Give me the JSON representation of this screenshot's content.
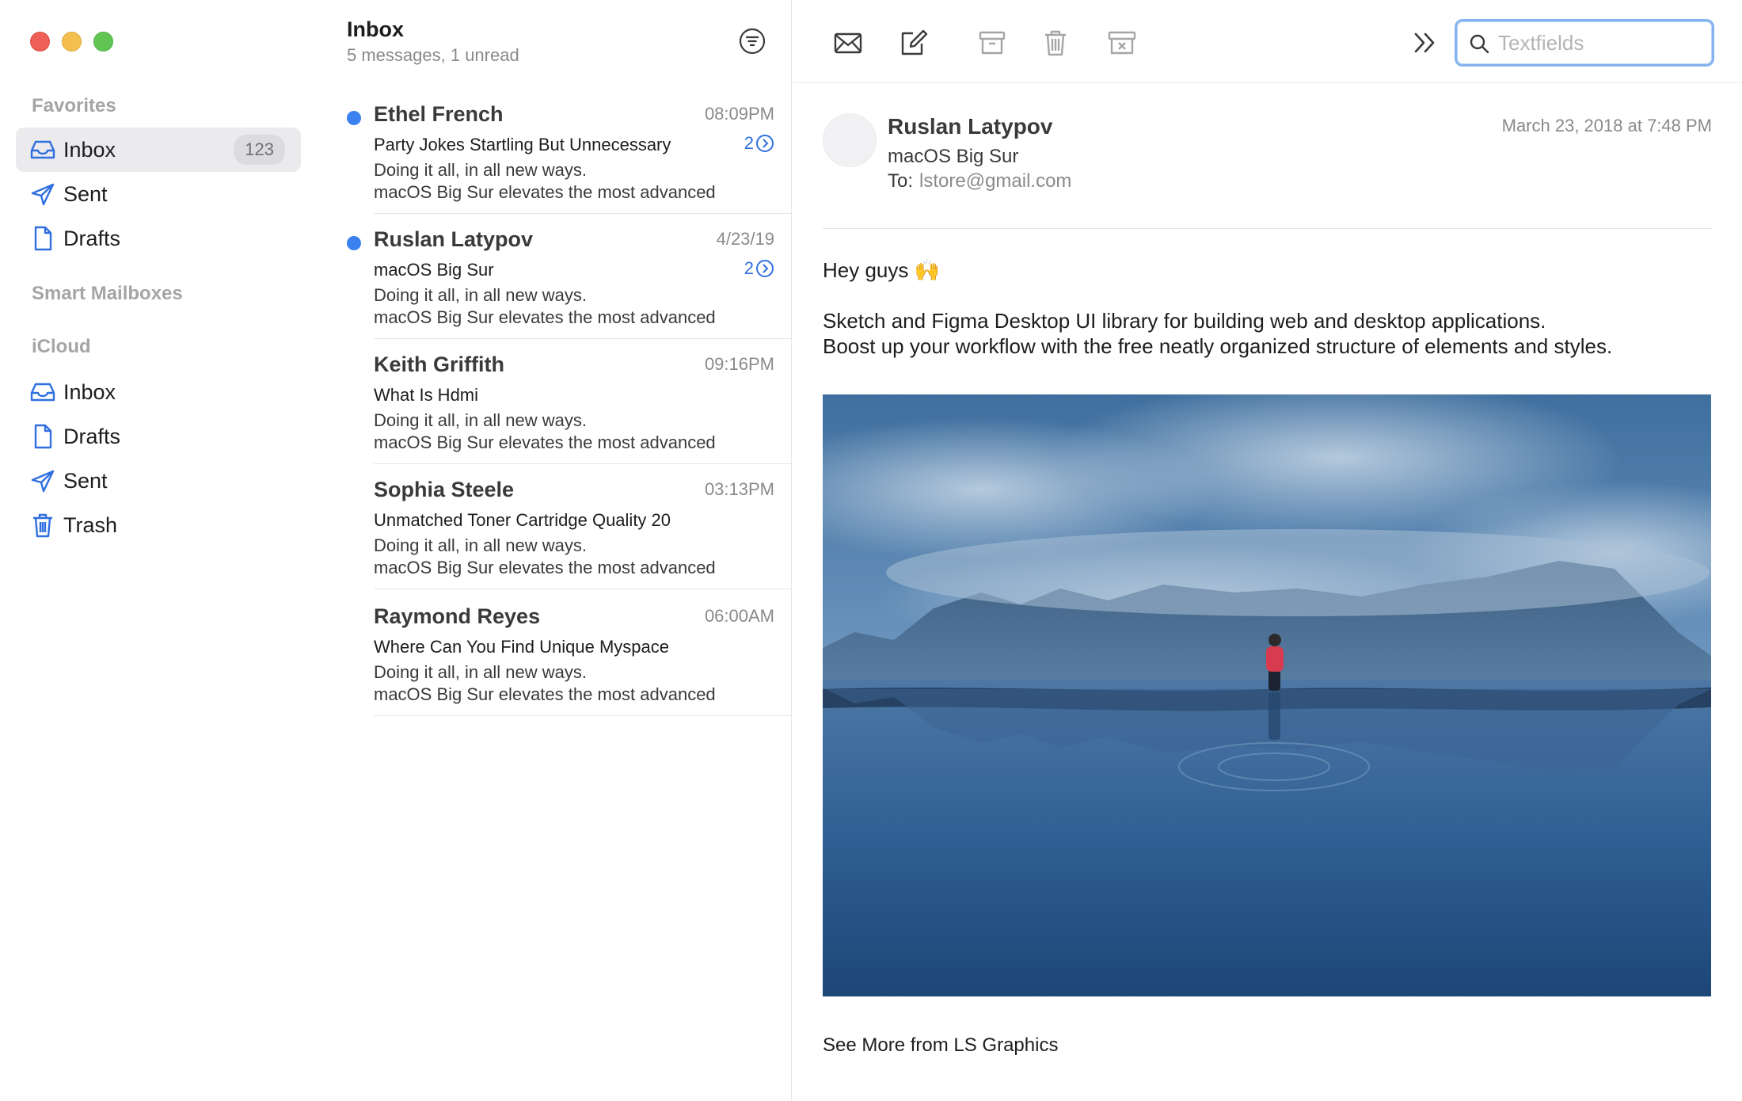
{
  "window": {
    "controls": [
      "close",
      "minimize",
      "zoom"
    ]
  },
  "sidebar": {
    "favorites_label": "Favorites",
    "favorites": [
      {
        "label": "Inbox",
        "icon": "inbox-icon",
        "count": "123",
        "active": true
      },
      {
        "label": "Sent",
        "icon": "paperplane-icon"
      },
      {
        "label": "Drafts",
        "icon": "document-icon"
      }
    ],
    "smart_label": "Smart Mailboxes",
    "icloud_label": "iCloud",
    "icloud": [
      {
        "label": "Inbox",
        "icon": "inbox-icon"
      },
      {
        "label": "Drafts",
        "icon": "document-icon"
      },
      {
        "label": "Sent",
        "icon": "paperplane-icon"
      },
      {
        "label": "Trash",
        "icon": "trash-icon"
      }
    ]
  },
  "list": {
    "title": "Inbox",
    "subtitle": "5 messages, 1 unread",
    "messages": [
      {
        "from": "Ethel French",
        "time": "08:09PM",
        "subject": "Party Jokes Startling But Unnecessary",
        "thread": "2",
        "unread": true,
        "preview1": "Doing it all, in all new ways.",
        "preview2": "macOS Big Sur elevates the most advanced"
      },
      {
        "from": "Ruslan Latypov",
        "time": "4/23/19",
        "subject": "macOS Big Sur",
        "thread": "2",
        "unread": true,
        "preview1": "Doing it all, in all new ways.",
        "preview2": "macOS Big Sur elevates the most advanced"
      },
      {
        "from": "Keith Griffith",
        "time": "09:16PM",
        "subject": "What Is Hdmi",
        "thread": "",
        "unread": false,
        "preview1": "Doing it all, in all new ways.",
        "preview2": "macOS Big Sur elevates the most advanced"
      },
      {
        "from": "Sophia Steele",
        "time": "03:13PM",
        "subject": "Unmatched Toner Cartridge Quality 20",
        "thread": "",
        "unread": false,
        "preview1": "Doing it all, in all new ways.",
        "preview2": "macOS Big Sur elevates the most advanced"
      },
      {
        "from": "Raymond Reyes",
        "time": "06:00AM",
        "subject": "Where Can You Find Unique Myspace",
        "thread": "",
        "unread": false,
        "preview1": "Doing it all, in all new ways.",
        "preview2": "macOS Big Sur elevates the most advanced"
      }
    ]
  },
  "toolbar": {
    "icons": [
      "envelope-icon",
      "compose-icon",
      "archive-icon",
      "trash-icon",
      "junk-icon",
      "chevron-double-right-icon"
    ],
    "search_placeholder": "Textfields"
  },
  "reader": {
    "sender": "Ruslan Latypov",
    "subject": "macOS Big Sur",
    "to_label": "To:",
    "to_address": "lstore@gmail.com",
    "date": "March 23, 2018 at 7:48 PM",
    "greeting": "Hey guys 🙌",
    "body_line1": "Sketch and Figma Desktop UI library for building web and desktop applications.",
    "body_line2": "Boost up your workflow with the free neatly organized structure of elements and styles.",
    "footer": "See More from LS Graphics"
  },
  "colors": {
    "accent": "#2f6fe0",
    "unread_dot": "#3b82f0",
    "sidebar_selected": "#ebebed"
  }
}
